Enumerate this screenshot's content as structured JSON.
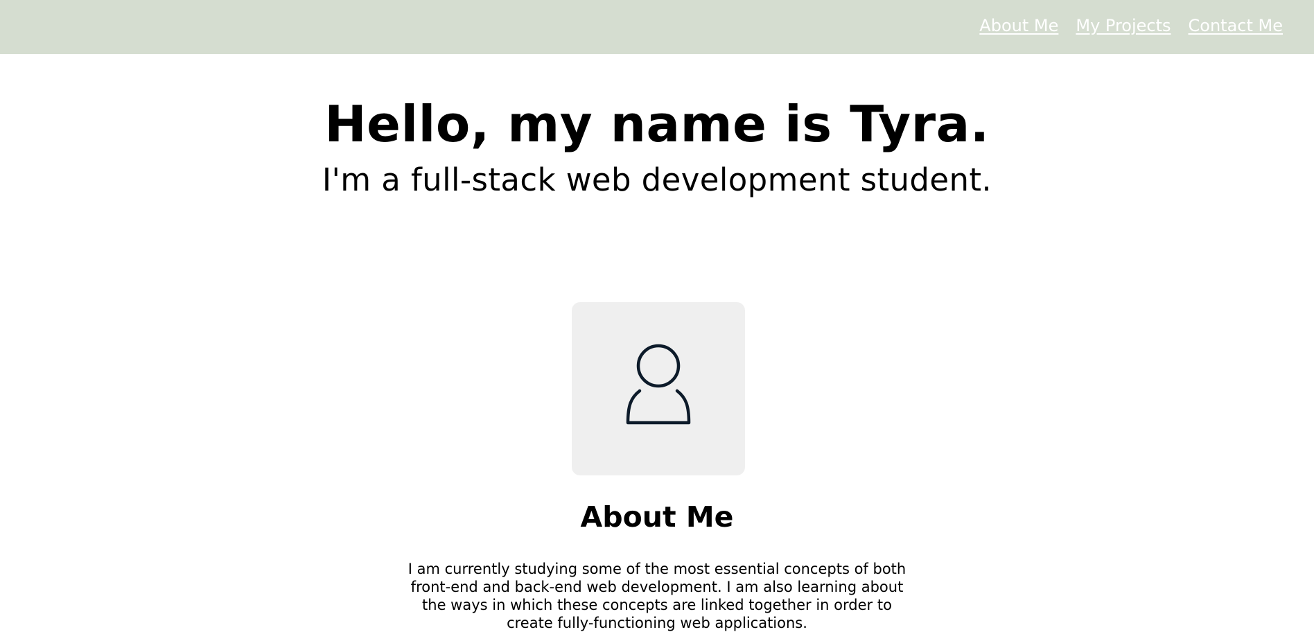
{
  "nav": {
    "items": [
      {
        "label": "About Me"
      },
      {
        "label": "My Projects"
      },
      {
        "label": "Contact Me"
      }
    ]
  },
  "hero": {
    "title": "Hello, my name is Tyra.",
    "subtitle": "I'm a full-stack web development student."
  },
  "about": {
    "avatar_icon": "person-icon",
    "title": "About Me",
    "text": "I am currently studying some of the most essential concepts of both front-end and back-end web development. I am also learning about the ways in which these concepts are linked together in order to create fully-functioning web applications."
  },
  "colors": {
    "header_bg": "#d5ddd0",
    "nav_link": "#ffffff",
    "avatar_bg": "#efefef",
    "icon_stroke": "#0d1b2a"
  }
}
